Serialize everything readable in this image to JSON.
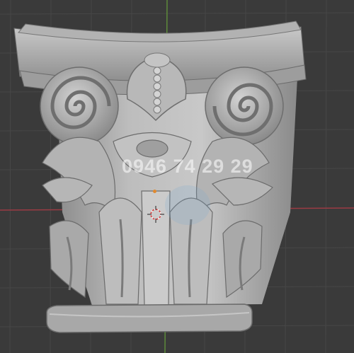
{
  "viewport": {
    "background": "#3a3a3a",
    "grid_color": "#454545",
    "x_axis_color": "#9b3b44",
    "y_axis_color": "#5d8a3a"
  },
  "watermark": {
    "text": "0946 74 29 29"
  },
  "scene": {
    "object": "corinthian-capital-model",
    "origin_color": "#e0892f"
  }
}
